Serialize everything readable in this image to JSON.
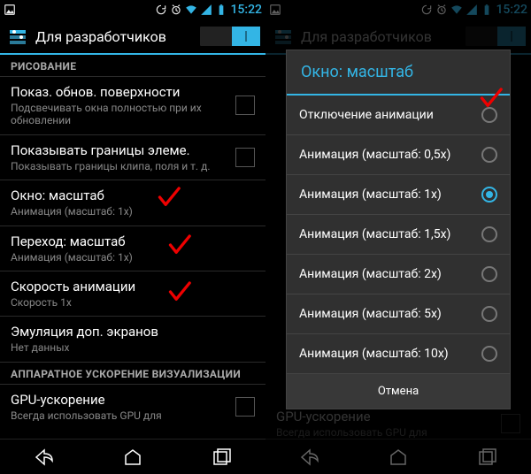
{
  "status": {
    "time": "15:22"
  },
  "action_bar": {
    "title": "Для разработчиков"
  },
  "left": {
    "section1": "РИСОВАНИЕ",
    "items": [
      {
        "title": "Показ. обнов. поверхности",
        "sub": "Подсвечивать окна полностью при их обновлении",
        "checkbox": true
      },
      {
        "title": "Показывать границы элеме.",
        "sub": "Показывать границы клипа, поля и т. д.",
        "checkbox": true
      },
      {
        "title": "Окно: масштаб",
        "sub": "Анимация (масштаб: 1x)"
      },
      {
        "title": "Переход: масштаб",
        "sub": "Анимация (масштаб: 1x)"
      },
      {
        "title": "Скорость анимации",
        "sub": "Скорость 1x"
      },
      {
        "title": "Эмуляция доп. экранов",
        "sub": "Нет данных"
      }
    ],
    "section2": "АППАРАТНОЕ УСКОРЕНИЕ ВИЗУАЛИЗАЦИИ",
    "gpu": {
      "title": "GPU-ускорение",
      "sub": "Всегда использовать GPU для"
    }
  },
  "dialog": {
    "title": "Окно: масштаб",
    "options": [
      "Отключение анимации",
      "Анимация (масштаб: 0,5x)",
      "Анимация (масштаб: 1x)",
      "Анимация (масштаб: 1,5x)",
      "Анимация (масштаб: 2x)",
      "Анимация (масштаб: 5x)",
      "Анимация (масштаб: 10x)"
    ],
    "selected_index": 2,
    "cancel": "Отмена"
  },
  "right_bg": {
    "gpu": {
      "title": "GPU-ускорение",
      "sub": "Всегда использовать GPU для"
    }
  }
}
